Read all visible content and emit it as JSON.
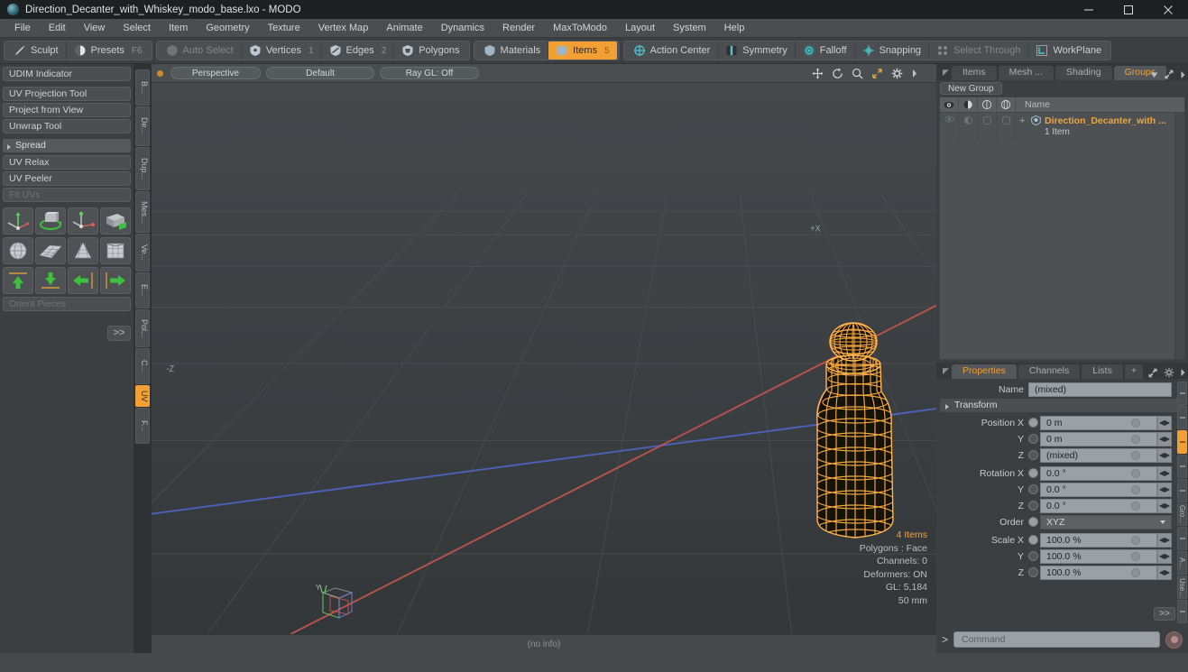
{
  "window": {
    "title": "Direction_Decanter_with_Whiskey_modo_base.lxo - MODO",
    "minimize": "minimize-button",
    "maximize": "maximize-button",
    "close": "close-button"
  },
  "menubar": {
    "items": [
      {
        "label": "File"
      },
      {
        "label": "Edit"
      },
      {
        "label": "View"
      },
      {
        "label": "Select"
      },
      {
        "label": "Item"
      },
      {
        "label": "Geometry"
      },
      {
        "label": "Texture"
      },
      {
        "label": "Vertex Map"
      },
      {
        "label": "Animate"
      },
      {
        "label": "Dynamics"
      },
      {
        "label": "Render"
      },
      {
        "label": "MaxToModo"
      },
      {
        "label": "Layout"
      },
      {
        "label": "System"
      },
      {
        "label": "Help"
      }
    ]
  },
  "toolbar": {
    "sculpt": "Sculpt",
    "presets": "Presets",
    "presets_shortcut": "F6",
    "auto_select": "Auto Select",
    "vertices": "Vertices",
    "vertices_num": "1",
    "edges": "Edges",
    "edges_num": "2",
    "polygons": "Polygons",
    "materials": "Materials",
    "items": "Items",
    "items_num": "5",
    "action_center": "Action Center",
    "symmetry": "Symmetry",
    "falloff": "Falloff",
    "snapping": "Snapping",
    "select_through": "Select Through",
    "workplane": "WorkPlane",
    "accent": "#f2a033"
  },
  "left_panel": {
    "udim": "UDIM Indicator",
    "tools": [
      "UV Projection Tool",
      "Project from View",
      "Unwrap Tool"
    ],
    "spread_header": "Spread",
    "spread_tools": [
      "UV Relax",
      "UV Peeler"
    ],
    "fit_uvs": "Fit UVs",
    "icon_rows": [
      [
        "uv-move-icon",
        "uv-rotate-icon",
        "uv-scale-icon",
        "uv-unwrap-icon"
      ],
      [
        "uv-sphere-map-icon",
        "uv-planar-map-icon",
        "uv-cone-map-icon",
        "uv-box-map-icon"
      ],
      [
        "uv-flip-up-icon",
        "uv-flip-down-icon",
        "uv-flip-left-icon",
        "uv-flip-right-icon"
      ]
    ],
    "orient_pieces": "Orient Pieces",
    "more": ">>",
    "vtabs": [
      {
        "label": "B...",
        "active": false
      },
      {
        "label": "De...",
        "active": false
      },
      {
        "label": "Dup...",
        "active": false
      },
      {
        "label": "Mes...",
        "active": false
      },
      {
        "label": "Ve...",
        "active": false
      },
      {
        "label": "E...",
        "active": false
      },
      {
        "label": "Pol...",
        "active": false
      },
      {
        "label": "C...",
        "active": false
      },
      {
        "label": "UV",
        "active": true
      },
      {
        "label": "F...",
        "active": false
      }
    ]
  },
  "viewport": {
    "view_mode": "Perspective",
    "shading": "Default",
    "raygl": "Ray GL: Off",
    "icons": [
      "move-icon",
      "rotate-icon",
      "zoom-icon",
      "fit-icon",
      "gear-icon",
      "chevron-right-icon"
    ],
    "axis_labels": {
      "x_pos": "+X",
      "z_neg": "-Z",
      "gizmo": "Y"
    },
    "stats": {
      "items": "4 Items",
      "polygons": "Polygons : Face",
      "channels": "Channels: 0",
      "deformers": "Deformers: ON",
      "gl": "GL: 5,184",
      "grid": "50 mm"
    },
    "footer": "(no info)",
    "colors": {
      "wireframe": "#f2a033",
      "x_axis": "#c0554f",
      "z_axis": "#4f63c0",
      "background": "#3a3e41"
    }
  },
  "right_panel": {
    "top_tabs": [
      {
        "label": "Items",
        "active": false
      },
      {
        "label": "Mesh ...",
        "active": false
      },
      {
        "label": "Shading",
        "active": false
      },
      {
        "label": "Groups",
        "active": true
      }
    ],
    "new_group": "New Group",
    "list_columns": [
      "eye-icon",
      "shading-icon",
      "render-icon",
      "lock-icon"
    ],
    "name_header": "Name",
    "rows": [
      {
        "label": "Direction_Decanter_with ...",
        "sub": "1 Item"
      }
    ],
    "props_tabs": [
      {
        "label": "Properties",
        "active": true
      },
      {
        "label": "Channels",
        "active": false
      },
      {
        "label": "Lists",
        "active": false
      },
      {
        "label": "+",
        "active": false
      }
    ],
    "name_label": "Name",
    "name_value": "(mixed)",
    "transform_header": "Transform",
    "fields": [
      {
        "label": "Position X",
        "value": "0 m",
        "type": "num"
      },
      {
        "label": "Y",
        "value": "0 m",
        "type": "num"
      },
      {
        "label": "Z",
        "value": "(mixed)",
        "type": "num"
      },
      {
        "label": "Rotation X",
        "value": "0.0 °",
        "type": "num"
      },
      {
        "label": "Y",
        "value": "0.0 °",
        "type": "num"
      },
      {
        "label": "Z",
        "value": "0.0 °",
        "type": "num"
      },
      {
        "label": "Order",
        "value": "XYZ",
        "type": "select"
      },
      {
        "label": "Scale X",
        "value": "100.0 %",
        "type": "num"
      },
      {
        "label": "Y",
        "value": "100.0 %",
        "type": "num"
      },
      {
        "label": "Z",
        "value": "100.0 %",
        "type": "num"
      }
    ],
    "more": ">>",
    "vtabs": [
      {
        "label": "...",
        "active": false
      },
      {
        "label": "...",
        "active": false
      },
      {
        "label": "...",
        "active": true
      },
      {
        "label": "...",
        "active": false
      },
      {
        "label": "...",
        "active": false
      },
      {
        "label": "Gro...",
        "active": false
      },
      {
        "label": "...",
        "active": false
      },
      {
        "label": "A...",
        "active": false
      },
      {
        "label": "Use...",
        "active": false
      },
      {
        "label": "...",
        "active": false
      }
    ]
  },
  "command_bar": {
    "prompt": ">",
    "placeholder": "Command",
    "record": "record-button"
  }
}
